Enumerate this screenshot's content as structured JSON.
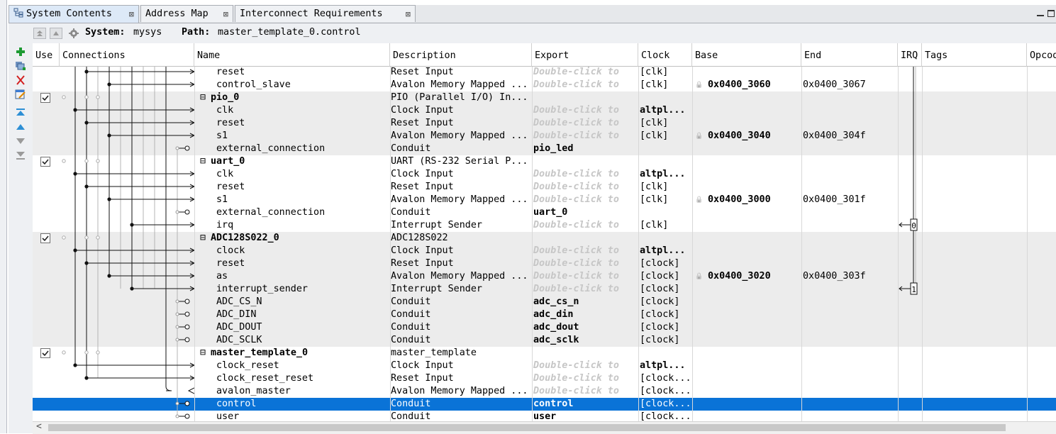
{
  "tabs": [
    {
      "label": "System Contents"
    },
    {
      "label": "Address Map"
    },
    {
      "label": "Interconnect Requirements"
    }
  ],
  "pathbar": {
    "system_label": "System:",
    "system_value": "mysys",
    "path_label": "Path:",
    "path_value": "master_template_0.control"
  },
  "columns": [
    {
      "label": "Use"
    },
    {
      "label": "Connections"
    },
    {
      "label": "Name"
    },
    {
      "label": "Description"
    },
    {
      "label": "Export"
    },
    {
      "label": "Clock"
    },
    {
      "label": "Base"
    },
    {
      "label": "End"
    },
    {
      "label": "IRQ"
    },
    {
      "label": "Tags"
    },
    {
      "label": "Opcode"
    }
  ],
  "rows": [
    {
      "name": "reset",
      "desc": "Reset Input",
      "export": "Double-click to",
      "clock": "[clk]",
      "base": "",
      "end": ""
    },
    {
      "name": "control_slave",
      "desc": "Avalon Memory Mapped ...",
      "export": "Double-click to",
      "clock": "[clk]",
      "base": "0x0400_3060",
      "end": "0x0400_3067"
    },
    {
      "name": "pio_0",
      "desc": "PIO (Parallel I/O) In...",
      "export": "",
      "clock": "",
      "base": "",
      "end": ""
    },
    {
      "name": "clk",
      "desc": "Clock Input",
      "export": "Double-click to",
      "clock": "altpl...",
      "base": "",
      "end": ""
    },
    {
      "name": "reset",
      "desc": "Reset Input",
      "export": "Double-click to",
      "clock": "[clk]",
      "base": "",
      "end": ""
    },
    {
      "name": "s1",
      "desc": "Avalon Memory Mapped ...",
      "export": "Double-click to",
      "clock": "[clk]",
      "base": "0x0400_3040",
      "end": "0x0400_304f"
    },
    {
      "name": "external_connection",
      "desc": "Conduit",
      "export": "pio_led",
      "clock": "",
      "base": "",
      "end": ""
    },
    {
      "name": "uart_0",
      "desc": "UART (RS-232 Serial P...",
      "export": "",
      "clock": "",
      "base": "",
      "end": ""
    },
    {
      "name": "clk",
      "desc": "Clock Input",
      "export": "Double-click to",
      "clock": "altpl...",
      "base": "",
      "end": ""
    },
    {
      "name": "reset",
      "desc": "Reset Input",
      "export": "Double-click to",
      "clock": "[clk]",
      "base": "",
      "end": ""
    },
    {
      "name": "s1",
      "desc": "Avalon Memory Mapped ...",
      "export": "Double-click to",
      "clock": "[clk]",
      "base": "0x0400_3000",
      "end": "0x0400_301f"
    },
    {
      "name": "external_connection",
      "desc": "Conduit",
      "export": "uart_0",
      "clock": "",
      "base": "",
      "end": ""
    },
    {
      "name": "irq",
      "desc": "Interrupt Sender",
      "export": "Double-click to",
      "clock": "[clk]",
      "base": "",
      "end": "",
      "irq": "0"
    },
    {
      "name": "ADC128S022_0",
      "desc": "ADC128S022",
      "export": "",
      "clock": "",
      "base": "",
      "end": ""
    },
    {
      "name": "clock",
      "desc": "Clock Input",
      "export": "Double-click to",
      "clock": "altpl...",
      "base": "",
      "end": ""
    },
    {
      "name": "reset",
      "desc": "Reset Input",
      "export": "Double-click to",
      "clock": "[clock]",
      "base": "",
      "end": ""
    },
    {
      "name": "as",
      "desc": "Avalon Memory Mapped ...",
      "export": "Double-click to",
      "clock": "[clock]",
      "base": "0x0400_3020",
      "end": "0x0400_303f"
    },
    {
      "name": "interrupt_sender",
      "desc": "Interrupt Sender",
      "export": "Double-click to",
      "clock": "[clock]",
      "base": "",
      "end": "",
      "irq": "1"
    },
    {
      "name": "ADC_CS_N",
      "desc": "Conduit",
      "export": "adc_cs_n",
      "clock": "[clock]",
      "base": "",
      "end": ""
    },
    {
      "name": "ADC_DIN",
      "desc": "Conduit",
      "export": "adc_din",
      "clock": "[clock]",
      "base": "",
      "end": ""
    },
    {
      "name": "ADC_DOUT",
      "desc": "Conduit",
      "export": "adc_dout",
      "clock": "[clock]",
      "base": "",
      "end": ""
    },
    {
      "name": "ADC_SCLK",
      "desc": "Conduit",
      "export": "adc_sclk",
      "clock": "[clock]",
      "base": "",
      "end": ""
    },
    {
      "name": "master_template_0",
      "desc": "master_template",
      "export": "",
      "clock": "",
      "base": "",
      "end": ""
    },
    {
      "name": "clock_reset",
      "desc": "Clock Input",
      "export": "Double-click to",
      "clock": "altpl...",
      "base": "",
      "end": ""
    },
    {
      "name": "clock_reset_reset",
      "desc": "Reset Input",
      "export": "Double-click to",
      "clock": "[clock...",
      "base": "",
      "end": ""
    },
    {
      "name": "avalon_master",
      "desc": "Avalon Memory Mapped ...",
      "export": "Double-click to",
      "clock": "[clock...",
      "base": "",
      "end": ""
    },
    {
      "name": "control",
      "desc": "Conduit",
      "export": "control",
      "clock": "[clock...",
      "base": "",
      "end": ""
    },
    {
      "name": "user",
      "desc": "Conduit",
      "export": "user",
      "clock": "[clock...",
      "base": "",
      "end": ""
    }
  ]
}
